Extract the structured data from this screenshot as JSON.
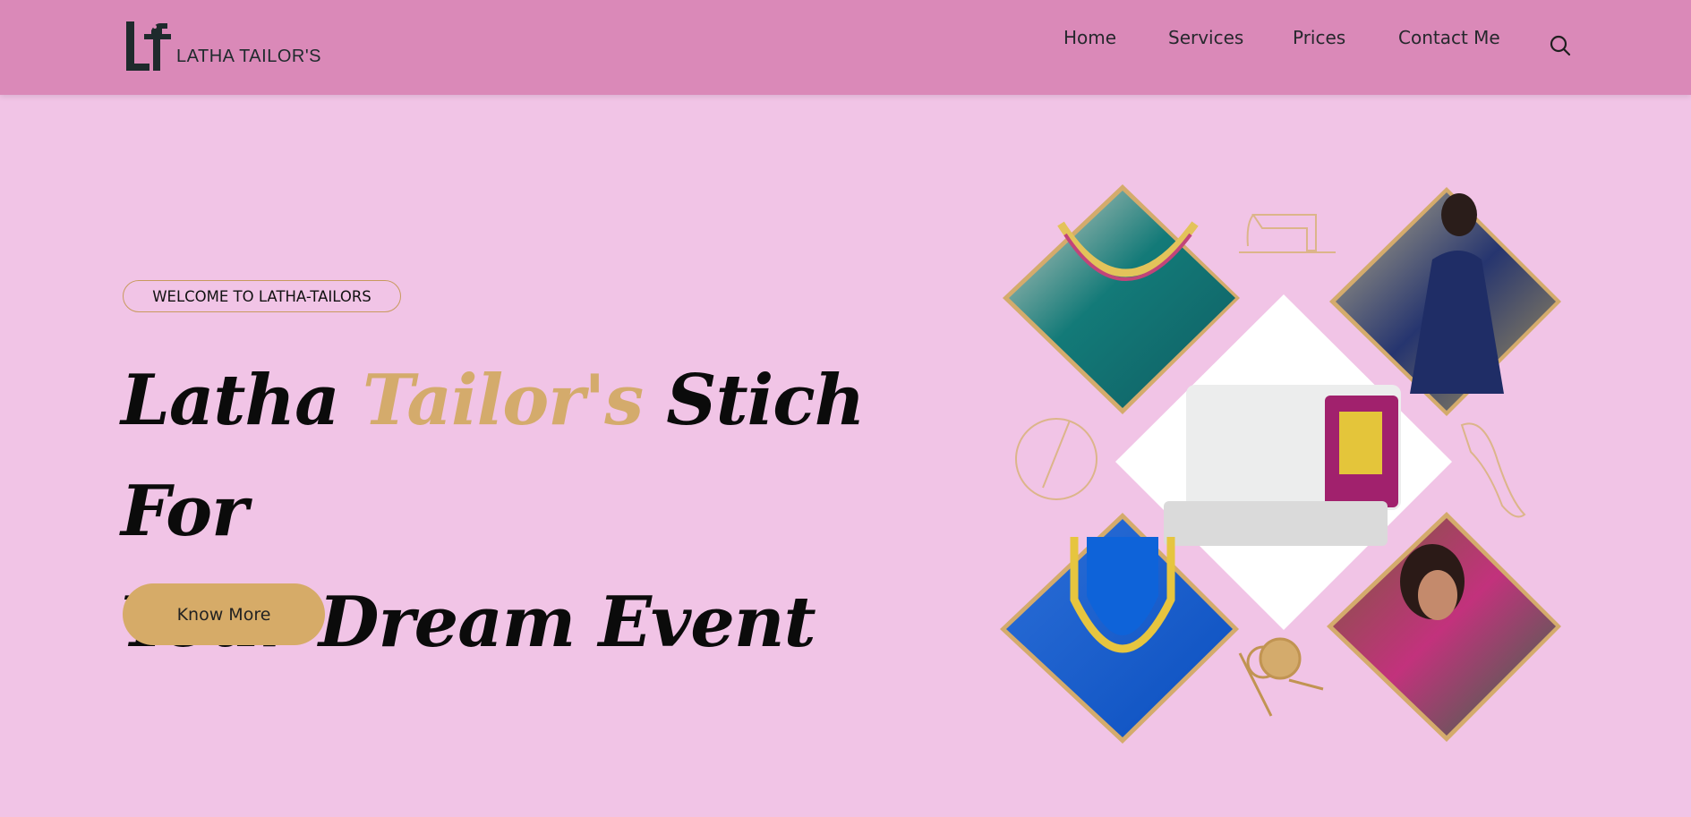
{
  "brand": {
    "logo_text": "LATHA TAILOR'S"
  },
  "nav": {
    "items": [
      {
        "label": "Home"
      },
      {
        "label": "Services"
      },
      {
        "label": "Prices"
      },
      {
        "label": "Contact Me"
      }
    ],
    "search_icon": "search-icon"
  },
  "hero": {
    "badge": "WELCOME TO LATHA-TAILORS",
    "title_part1": "Latha ",
    "title_accent": "Tailor's",
    "title_part2": " Stich For",
    "title_line2": "Your Dream Event",
    "button_label": "Know More"
  },
  "images": {
    "top_left": "green-embroidered-blouse-photo",
    "top_right": "woman-in-navy-dress-photo",
    "center": "sewing-machine-photo",
    "bottom_left": "blue-embroidered-blouse-photo",
    "bottom_right": "woman-in-silk-saree-photo"
  },
  "colors": {
    "header_bg": "#da89b8",
    "page_bg": "#f1c4e6",
    "accent_gold": "#d4ab6c",
    "button_bg": "#d6ab68"
  }
}
